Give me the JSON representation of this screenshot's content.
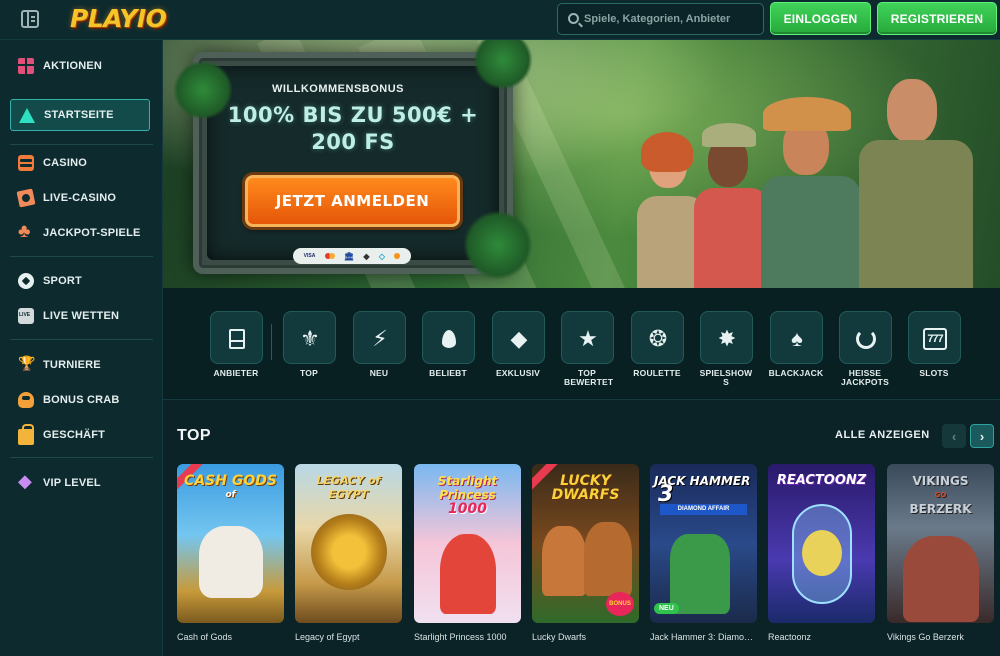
{
  "header": {
    "logo_text": "PLAYIO",
    "search_placeholder": "Spiele, Kategorien, Anbieter",
    "login_label": "EINLOGGEN",
    "register_label": "REGISTRIEREN"
  },
  "sidebar": {
    "items": [
      {
        "label": "AKTIONEN",
        "icon": "gift-icon"
      },
      {
        "label": "STARTSEITE",
        "icon": "home-icon",
        "active": true
      },
      {
        "label": "CASINO",
        "icon": "slot-machine-icon"
      },
      {
        "label": "LIVE-CASINO",
        "icon": "cards-icon"
      },
      {
        "label": "JACKPOT-SPIELE",
        "icon": "clover-icon"
      },
      {
        "label": "SPORT",
        "icon": "football-icon"
      },
      {
        "label": "LIVE WETTEN",
        "icon": "live-icon"
      },
      {
        "label": "TURNIERE",
        "icon": "trophy-icon"
      },
      {
        "label": "BONUS CRAB",
        "icon": "crab-icon"
      },
      {
        "label": "GESCHÄFT",
        "icon": "shopping-bag-icon"
      },
      {
        "label": "VIP LEVEL",
        "icon": "diamond-icon"
      }
    ]
  },
  "hero": {
    "welcome_label": "WILLKOMMENSBONUS",
    "bonus_line1": "100% BIS ZU 500€ +",
    "bonus_line2": "200 FS",
    "cta_label": "JETZT ANMELDEN",
    "payment_visa": "VISA"
  },
  "categories": [
    {
      "label": "ANBIETER",
      "icon": "provider-icon"
    },
    {
      "label": "TOP",
      "icon": "fleur-icon"
    },
    {
      "label": "NEU",
      "icon": "lightning-icon"
    },
    {
      "label": "BELIEBT",
      "icon": "flame-icon"
    },
    {
      "label": "EXKLUSIV",
      "icon": "diamond-icon"
    },
    {
      "label": "TOP BEWERTET",
      "icon": "star-icon"
    },
    {
      "label": "ROULETTE",
      "icon": "roulette-icon"
    },
    {
      "label": "SPIELSHOWS",
      "icon": "wheel-icon"
    },
    {
      "label": "BLACKJACK",
      "icon": "spade-icon"
    },
    {
      "label": "HEISSE JACKPOTS",
      "icon": "hot-jackpot-icon"
    },
    {
      "label": "SLOTS",
      "icon": "slot-777-icon"
    }
  ],
  "games_section": {
    "title": "TOP",
    "view_all_label": "ALLE ANZEIGEN",
    "games": [
      {
        "name": "Cash of Gods",
        "art_title": "CASH GODS",
        "art_word": "of"
      },
      {
        "name": "Legacy of Egypt",
        "art_title": "LEGACY of EGYPT"
      },
      {
        "name": "Starlight Princess 1000",
        "art_title": "Starlight Princess",
        "art_number": "1000"
      },
      {
        "name": "Lucky Dwarfs",
        "art_title": "LUCKY DWARFS",
        "art_badge": "BONUS"
      },
      {
        "name": "Jack Hammer 3: Diamond Affair",
        "art_title": "JACK HAMMER",
        "art_number": "3",
        "art_subtitle": "DIAMOND AFFAIR",
        "badge": "NEU"
      },
      {
        "name": "Reactoonz",
        "art_title": "REACTOONZ"
      },
      {
        "name": "Vikings Go Berzerk",
        "art_title": "VIKINGS",
        "art_word": "GO",
        "art_title2": "BERZERK"
      }
    ]
  },
  "colors": {
    "brand_green": "#2fc24c",
    "accent_teal": "#32b2a8",
    "cta_orange": "#ff7a12",
    "logo_gold": "#f5c428"
  }
}
